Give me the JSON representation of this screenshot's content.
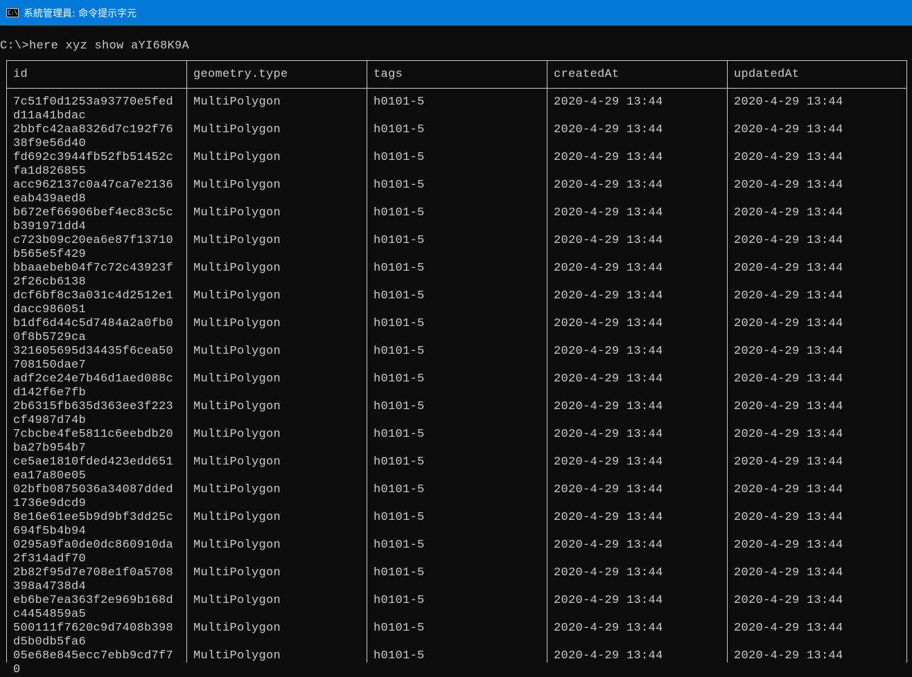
{
  "window": {
    "title": "系統管理員: 命令提示字元",
    "icon": "cmd-icon",
    "icon_text": "C:\\."
  },
  "console": {
    "command": "C:\\>here xyz show aYI68K9A",
    "columns": [
      "id",
      "geometry.type",
      "tags",
      "createdAt",
      "updatedAt"
    ],
    "rows": [
      {
        "id": "7c51f0d1253a93770e5fedd11a41bdac",
        "type": "MultiPolygon",
        "tags": "h0101-5",
        "createdAt": "2020-4-29 13:44",
        "updatedAt": "2020-4-29 13:44"
      },
      {
        "id": "2bbfc42aa8326d7c192f7638f9e56d40",
        "type": "MultiPolygon",
        "tags": "h0101-5",
        "createdAt": "2020-4-29 13:44",
        "updatedAt": "2020-4-29 13:44"
      },
      {
        "id": "fd692c3944fb52fb51452cfa1d826855",
        "type": "MultiPolygon",
        "tags": "h0101-5",
        "createdAt": "2020-4-29 13:44",
        "updatedAt": "2020-4-29 13:44"
      },
      {
        "id": "acc962137c0a47ca7e2136eab439aed8",
        "type": "MultiPolygon",
        "tags": "h0101-5",
        "createdAt": "2020-4-29 13:44",
        "updatedAt": "2020-4-29 13:44"
      },
      {
        "id": "b672ef66906bef4ec83c5cb391971dd4",
        "type": "MultiPolygon",
        "tags": "h0101-5",
        "createdAt": "2020-4-29 13:44",
        "updatedAt": "2020-4-29 13:44"
      },
      {
        "id": "c723b09c20ea6e87f13710b565e5f429",
        "type": "MultiPolygon",
        "tags": "h0101-5",
        "createdAt": "2020-4-29 13:44",
        "updatedAt": "2020-4-29 13:44"
      },
      {
        "id": "bbaaebeb04f7c72c43923f2f26cb6138",
        "type": "MultiPolygon",
        "tags": "h0101-5",
        "createdAt": "2020-4-29 13:44",
        "updatedAt": "2020-4-29 13:44"
      },
      {
        "id": "dcf6bf8c3a031c4d2512e1dacc986051",
        "type": "MultiPolygon",
        "tags": "h0101-5",
        "createdAt": "2020-4-29 13:44",
        "updatedAt": "2020-4-29 13:44"
      },
      {
        "id": "b1df6d44c5d7484a2a0fb00f8b5729ca",
        "type": "MultiPolygon",
        "tags": "h0101-5",
        "createdAt": "2020-4-29 13:44",
        "updatedAt": "2020-4-29 13:44"
      },
      {
        "id": "321605695d34435f6cea50708150dae7",
        "type": "MultiPolygon",
        "tags": "h0101-5",
        "createdAt": "2020-4-29 13:44",
        "updatedAt": "2020-4-29 13:44"
      },
      {
        "id": "adf2ce24e7b46d1aed088cd142f6e7fb",
        "type": "MultiPolygon",
        "tags": "h0101-5",
        "createdAt": "2020-4-29 13:44",
        "updatedAt": "2020-4-29 13:44"
      },
      {
        "id": "2b6315fb635d363ee3f223cf4987d74b",
        "type": "MultiPolygon",
        "tags": "h0101-5",
        "createdAt": "2020-4-29 13:44",
        "updatedAt": "2020-4-29 13:44"
      },
      {
        "id": "7cbcbe4fe5811c6eebdb20ba27b954b7",
        "type": "MultiPolygon",
        "tags": "h0101-5",
        "createdAt": "2020-4-29 13:44",
        "updatedAt": "2020-4-29 13:44"
      },
      {
        "id": "ce5ae1810fded423edd651ea17a80e05",
        "type": "MultiPolygon",
        "tags": "h0101-5",
        "createdAt": "2020-4-29 13:44",
        "updatedAt": "2020-4-29 13:44"
      },
      {
        "id": "02bfb0875036a34087dded1736e9dcd9",
        "type": "MultiPolygon",
        "tags": "h0101-5",
        "createdAt": "2020-4-29 13:44",
        "updatedAt": "2020-4-29 13:44"
      },
      {
        "id": "8e16e61ee5b9d9bf3dd25c694f5b4b94",
        "type": "MultiPolygon",
        "tags": "h0101-5",
        "createdAt": "2020-4-29 13:44",
        "updatedAt": "2020-4-29 13:44"
      },
      {
        "id": "0295a9fa0de0dc860910da2f314adf70",
        "type": "MultiPolygon",
        "tags": "h0101-5",
        "createdAt": "2020-4-29 13:44",
        "updatedAt": "2020-4-29 13:44"
      },
      {
        "id": "2b82f95d7e708e1f0a5708398a4738d4",
        "type": "MultiPolygon",
        "tags": "h0101-5",
        "createdAt": "2020-4-29 13:44",
        "updatedAt": "2020-4-29 13:44"
      },
      {
        "id": "eb6be7ea363f2e969b168dc4454859a5",
        "type": "MultiPolygon",
        "tags": "h0101-5",
        "createdAt": "2020-4-29 13:44",
        "updatedAt": "2020-4-29 13:44"
      },
      {
        "id": "500111f7620c9d7408b398d5b0db5fa6",
        "type": "MultiPolygon",
        "tags": "h0101-5",
        "createdAt": "2020-4-29 13:44",
        "updatedAt": "2020-4-29 13:44"
      },
      {
        "id": "05e68e845ecc7ebb9cd7f70",
        "type": "MultiPolygon",
        "tags": "h0101-5",
        "createdAt": "2020-4-29 13:44",
        "updatedAt": "2020-4-29 13:44"
      }
    ]
  }
}
